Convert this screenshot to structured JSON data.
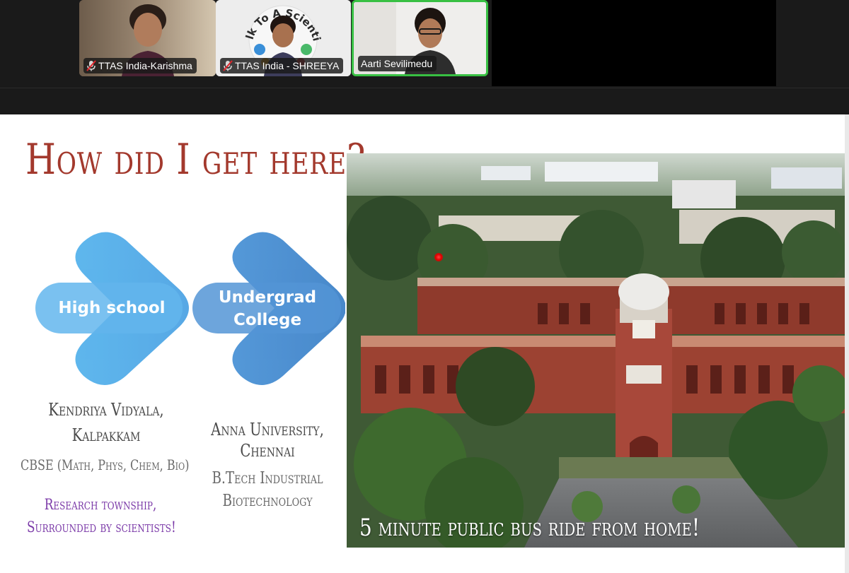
{
  "participants": [
    {
      "name": "TTAS India-Karishma",
      "muted": true
    },
    {
      "name": "TTAS India - SHREEYA",
      "muted": true
    },
    {
      "name": "Aarti Sevilimedu",
      "muted": false,
      "active_speaker": true
    }
  ],
  "logo_text": "Talk To A Scientist",
  "slide": {
    "title": "How did I get here?",
    "steps": [
      {
        "label_line1": "High school",
        "label_line2": ""
      },
      {
        "label_line1": "Undergrad",
        "label_line2": "College"
      }
    ],
    "school": {
      "name_line1": "Kendriya Vidyala,",
      "name_line2": "Kalpakkam",
      "detail": "CBSE (Math, Phys, Chem, Bio)",
      "note_line1": "Research township,",
      "note_line2": "Surrounded by scientists!"
    },
    "college": {
      "name_line1": "Anna University,",
      "name_line2": "Chennai",
      "detail_line1": "B.Tech Industrial",
      "detail_line2": "Biotechnology"
    },
    "photo_caption": "5 minute public bus ride from home!"
  },
  "colors": {
    "title": "#a3392d",
    "chevron_light": "#5aaee8",
    "chevron_dark": "#4a8fd3",
    "caption_dark": "#4a4a4a",
    "caption_gray": "#6a6a6a",
    "caption_purple": "#7b3aa8",
    "active_speaker_border": "#38c043"
  },
  "icons": [
    "muted-mic-icon",
    "laser-pointer-icon"
  ]
}
